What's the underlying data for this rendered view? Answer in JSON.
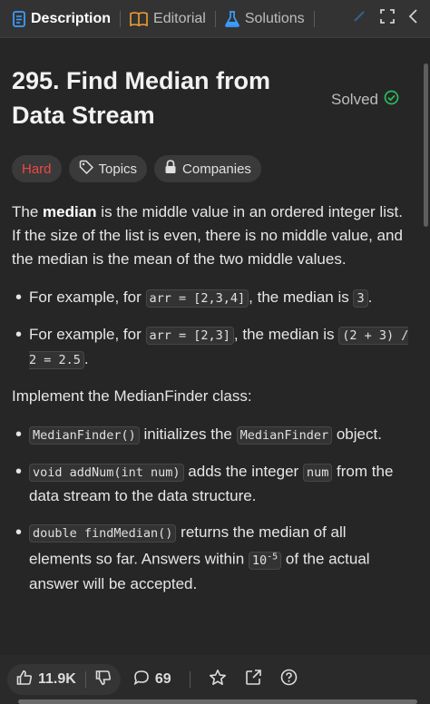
{
  "tabs": [
    {
      "label": "Description",
      "icon": "description-icon",
      "active": true
    },
    {
      "label": "Editorial",
      "icon": "book-icon",
      "active": false
    },
    {
      "label": "Solutions",
      "icon": "flask-icon",
      "active": false
    }
  ],
  "problem": {
    "title": "295. Find Median from Data Stream",
    "status": "Solved",
    "difficulty": "Hard",
    "tags": [
      "Topics",
      "Companies"
    ]
  },
  "description": {
    "intro_lead": "The ",
    "intro_bold": "median",
    "intro_rest": " is the middle value in an ordered integer list. If the size of the list is even, there is no middle value, and the median is the mean of the two middle values.",
    "ex1_pre": "For example, for ",
    "ex1_code": "arr = [2,3,4]",
    "ex1_mid": ", the median is ",
    "ex1_val": "3",
    "ex1_end": ".",
    "ex2_pre": "For example, for ",
    "ex2_code": "arr = [2,3]",
    "ex2_mid": ", the median is ",
    "ex2_val": "(2 + 3) / 2 = 2.5",
    "ex2_end": ".",
    "implement": "Implement the MedianFinder class:",
    "m1_code": "MedianFinder()",
    "m1_mid": " initializes the ",
    "m1_code2": "MedianFinder",
    "m1_end": " object.",
    "m2_code": "void addNum(int num)",
    "m2_mid": " adds the integer ",
    "m2_code2": "num",
    "m2_end": " from the data stream to the data structure.",
    "m3_code": "double findMedian()",
    "m3_mid": " returns the median of all elements so far. Answers within ",
    "m3_code2_base": "10",
    "m3_code2_exp": "-5",
    "m3_end": " of the actual answer will be accepted."
  },
  "footer": {
    "likes": "11.9K",
    "comments": "69"
  },
  "colors": {
    "hard": "#ef4743",
    "solved": "#2cbb5d",
    "tab_active": "#ffffff"
  }
}
